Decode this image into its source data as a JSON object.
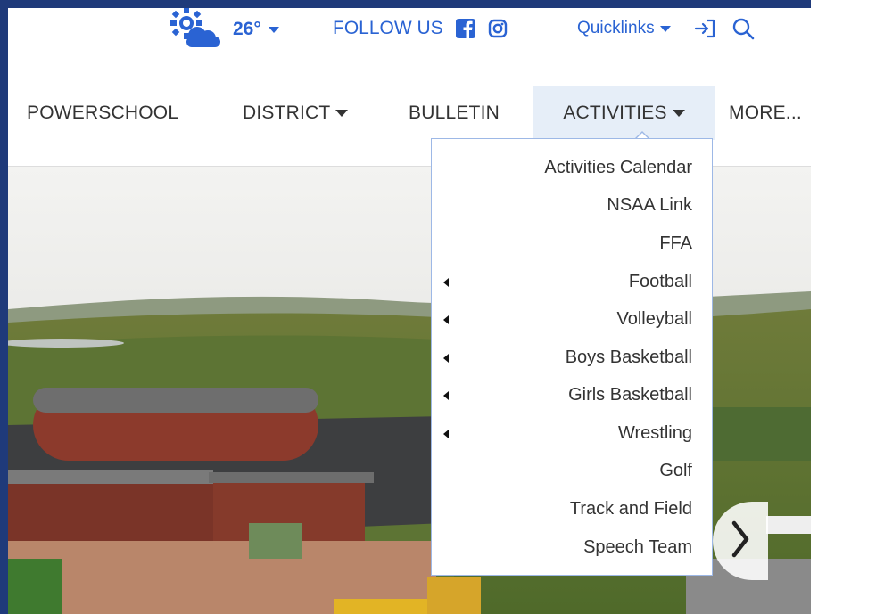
{
  "header": {
    "weather": {
      "icon": "partly-cloudy-sun-icon",
      "temperature": "26°"
    },
    "follow_label": "FOLLOW US",
    "social": [
      {
        "icon": "facebook-icon"
      },
      {
        "icon": "instagram-icon"
      }
    ],
    "quicklinks_label": "Quicklinks",
    "login_icon": "login-icon",
    "search_icon": "search-icon",
    "accent_color": "#2a63d3"
  },
  "nav": {
    "items": [
      {
        "label": "POWERSCHOOL",
        "has_dropdown": false
      },
      {
        "label": "DISTRICT",
        "has_dropdown": true
      },
      {
        "label": "BULLETIN",
        "has_dropdown": false
      },
      {
        "label": "ACTIVITIES",
        "has_dropdown": true,
        "active": true
      },
      {
        "label": "MORE...",
        "has_dropdown": false
      }
    ]
  },
  "activities_menu": {
    "items": [
      {
        "label": "Activities Calendar",
        "has_submenu": false
      },
      {
        "label": "NSAA Link",
        "has_submenu": false
      },
      {
        "label": "FFA",
        "has_submenu": false
      },
      {
        "label": "Football",
        "has_submenu": true
      },
      {
        "label": "Volleyball",
        "has_submenu": true
      },
      {
        "label": "Boys Basketball",
        "has_submenu": true
      },
      {
        "label": "Girls Basketball",
        "has_submenu": true
      },
      {
        "label": "Wrestling",
        "has_submenu": true
      },
      {
        "label": "Golf",
        "has_submenu": false
      },
      {
        "label": "Track and Field",
        "has_submenu": false
      },
      {
        "label": "Speech Team",
        "has_submenu": false
      }
    ]
  },
  "hero": {
    "next_icon": "chevron-right-icon"
  }
}
